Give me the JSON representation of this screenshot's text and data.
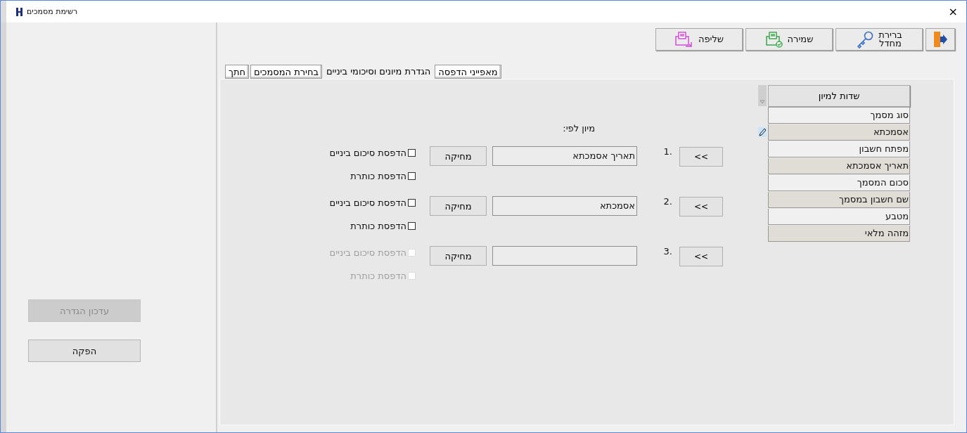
{
  "window": {
    "title": "רשימת מסמכים",
    "close": "×"
  },
  "toolbar": [
    {
      "kind": "exit"
    },
    {
      "kind": "key",
      "label": "ברירת\nמחדל"
    },
    {
      "kind": "save",
      "label": "שמירה"
    },
    {
      "kind": "load",
      "label": "שליפה"
    }
  ],
  "tabs": [
    {
      "label": "מאפייני הדפסה",
      "selected": false
    },
    {
      "label": "הגדרת מיונים וסיכומי ביניים",
      "selected": true
    },
    {
      "label": "בחירת המסמכים",
      "selected": false
    },
    {
      "label": "חתך",
      "selected": false
    }
  ],
  "sort_fields": {
    "header": "שדות למיון",
    "items": [
      {
        "label": "סוג מסמך",
        "editing": false
      },
      {
        "label": "אסמכתא",
        "editing": true
      },
      {
        "label": "מפתח חשבון",
        "editing": false
      },
      {
        "label": "תאריך אסמכתא",
        "editing": false
      },
      {
        "label": "סכום המסמך",
        "editing": false
      },
      {
        "label": "שם חשבון במסמך",
        "editing": false
      },
      {
        "label": "מטבע",
        "editing": false
      },
      {
        "label": "מזהה מלאי",
        "editing": false
      }
    ]
  },
  "sort_by_label": "מיון לפי:",
  "sort_rows": [
    {
      "arrow": "<<",
      "number": "1.",
      "value": "תאריך אסמכתא",
      "delete": "מחיקה",
      "options": [
        {
          "label": "הדפסת סיכום ביניים",
          "checked": false,
          "disabled": false
        },
        {
          "label": "הדפסת כותרת",
          "checked": false,
          "disabled": false
        }
      ]
    },
    {
      "arrow": "<<",
      "number": "2.",
      "value": "אסמכתא",
      "delete": "מחיקה",
      "options": [
        {
          "label": "הדפסת סיכום ביניים",
          "checked": false,
          "disabled": false
        },
        {
          "label": "הדפסת כותרת",
          "checked": false,
          "disabled": false
        }
      ]
    },
    {
      "arrow": "<<",
      "number": "3.",
      "delete": "מחיקה",
      "options": [
        {
          "label": "הדפסת סיכום ביניים",
          "checked": false,
          "disabled": true
        },
        {
          "label": "הדפסת כותרת",
          "checked": false,
          "disabled": true
        }
      ]
    }
  ],
  "side_buttons": [
    {
      "label": "עדכון הגדרה",
      "disabled": true
    },
    {
      "label": "הפקה",
      "disabled": false
    }
  ]
}
